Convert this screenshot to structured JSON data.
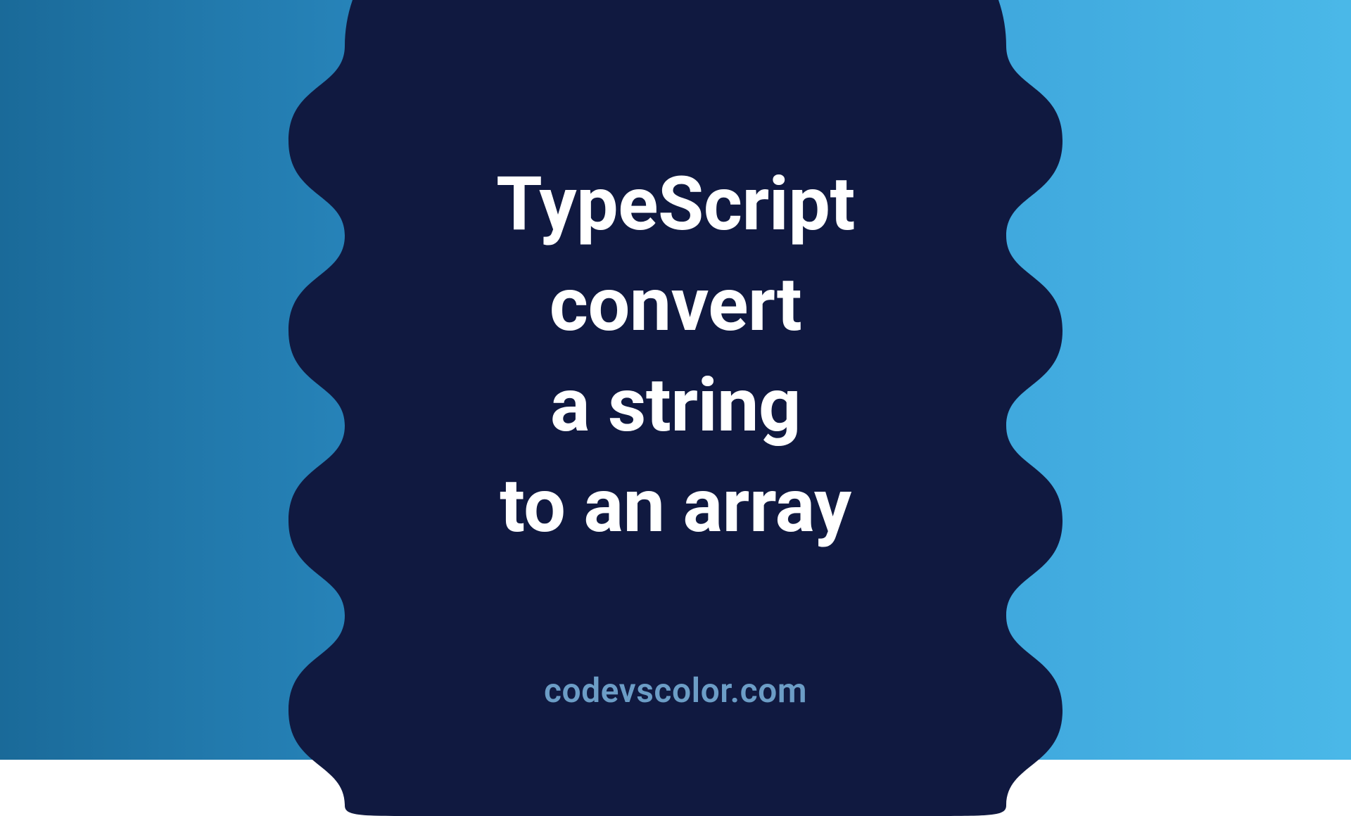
{
  "title": {
    "line1": "TypeScript",
    "line2": "convert",
    "line3": "a string",
    "line4": "to an array"
  },
  "footer": {
    "site": "codevscolor.com"
  },
  "colors": {
    "blob": "#101940",
    "text": "#ffffff",
    "site": "#6c9dc6"
  }
}
